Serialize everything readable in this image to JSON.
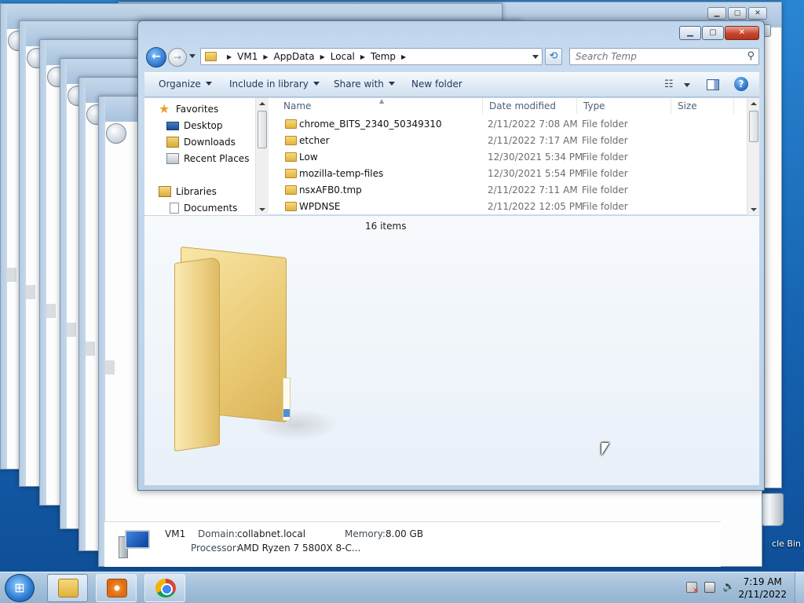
{
  "window": {
    "controls": {
      "minimize": "▁",
      "maximize": "▢",
      "close": "✕"
    }
  },
  "address": {
    "crumbs": [
      "VM1",
      "AppData",
      "Local",
      "Temp"
    ],
    "separator": "▶",
    "refresh_icon": "⟲"
  },
  "search": {
    "placeholder": "Search Temp",
    "icon": "⚲"
  },
  "toolbar": {
    "organize": "Organize",
    "include_in_library": "Include in library",
    "share_with": "Share with",
    "new_folder": "New folder",
    "views_icon": "☷",
    "help_icon": "?"
  },
  "navpane": {
    "items": [
      {
        "label": "Favorites",
        "icon": "star-icon"
      },
      {
        "label": "Desktop",
        "icon": "desktop-icon"
      },
      {
        "label": "Downloads",
        "icon": "downloads-icon"
      },
      {
        "label": "Recent Places",
        "icon": "recent-places-icon"
      },
      {
        "label": "Libraries",
        "icon": "libraries-icon"
      },
      {
        "label": "Documents",
        "icon": "documents-icon"
      }
    ]
  },
  "filelist": {
    "columns": [
      "Name",
      "Date modified",
      "Type",
      "Size"
    ],
    "rows": [
      {
        "name": "chrome_BITS_2340_50349310",
        "date": "2/11/2022 7:08 AM",
        "type": "File folder"
      },
      {
        "name": "etcher",
        "date": "2/11/2022 7:17 AM",
        "type": "File folder"
      },
      {
        "name": "Low",
        "date": "12/30/2021 5:34 PM",
        "type": "File folder"
      },
      {
        "name": "mozilla-temp-files",
        "date": "12/30/2021 5:54 PM",
        "type": "File folder"
      },
      {
        "name": "nsxAFB0.tmp",
        "date": "2/11/2022 7:11 AM",
        "type": "File folder"
      },
      {
        "name": "WPDNSE",
        "date": "2/11/2022 12:05 PM",
        "type": "File folder"
      }
    ]
  },
  "details": {
    "item_count": "16 items"
  },
  "sysinfo": {
    "computer_name": "VM1",
    "domain_label": "Domain:",
    "domain": "collabnet.local",
    "memory_label": "Memory:",
    "memory": "8.00 GB",
    "processor_label": "Processor:",
    "processor": "AMD Ryzen 7 5800X 8-C..."
  },
  "desktop": {
    "recycle_bin_label": "cle Bin"
  },
  "taskbar": {
    "time": "7:19 AM",
    "date": "2/11/2022",
    "volume_icon": "🔊"
  }
}
